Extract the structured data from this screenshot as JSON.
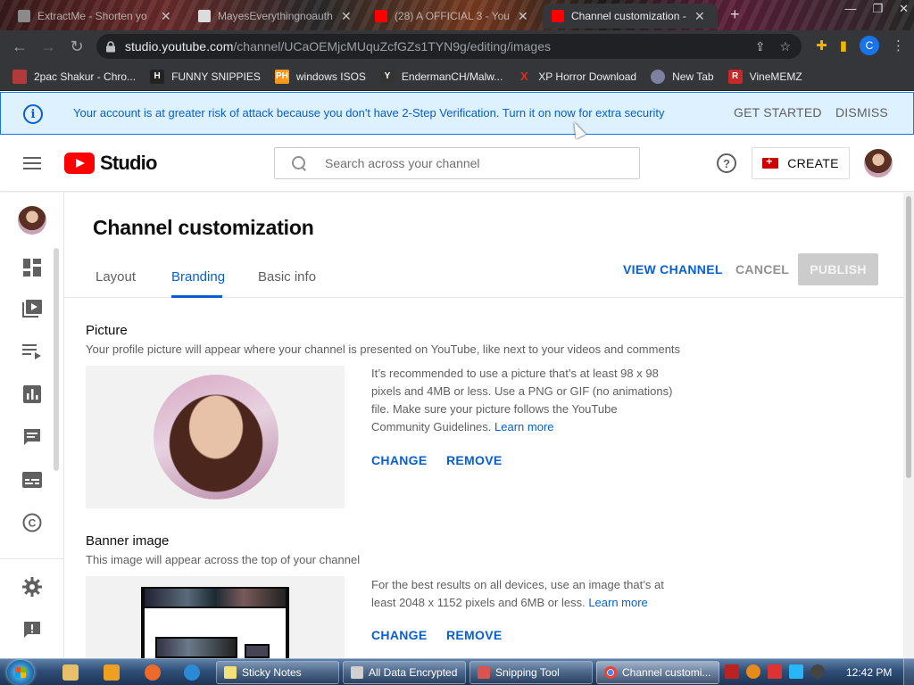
{
  "browser": {
    "tabs": [
      {
        "title": "ExtractMe - Shorten yo",
        "favicon_color": "#8a8a8a",
        "active": false
      },
      {
        "title": "MayesEverythingnoauth",
        "favicon_color": "#dcdcdc",
        "active": false
      },
      {
        "title": "(28) A OFFICIAL 3 - You",
        "favicon_color": "#ff0000",
        "active": false
      },
      {
        "title": "Channel customization -",
        "favicon_color": "#ff0000",
        "active": true
      }
    ],
    "url_host": "studio.youtube.com",
    "url_path": "/channel/UCaOEMjcMUquZcfGZs1TYN9g/editing/images",
    "profile_initial": "C",
    "bookmarks": [
      {
        "label": "2pac Shakur - Chro...",
        "icon": "",
        "color": "#b33a3a"
      },
      {
        "label": "FUNNY SNIPPIES",
        "icon": "H",
        "color": "#222222"
      },
      {
        "label": "windows ISOS",
        "icon": "PH",
        "color": "#f7971d"
      },
      {
        "label": "EndermanCH/Malw...",
        "icon": "Y",
        "color": "#333333"
      },
      {
        "label": "XP Horror Download",
        "icon": "X",
        "color": "#d93025"
      },
      {
        "label": "New Tab",
        "icon": "",
        "color": "#7f7f9f"
      },
      {
        "label": "VineMEMZ",
        "icon": "R",
        "color": "#c62828"
      }
    ]
  },
  "banner": {
    "message": "Your account is at greater risk of attack because you don't have 2-Step Verification. Turn it on now for extra security",
    "get_started": "GET STARTED",
    "dismiss": "DISMISS",
    "color": "#065fd4"
  },
  "header": {
    "brand": "Studio",
    "search_placeholder": "Search across your channel",
    "create_label": "CREATE"
  },
  "page": {
    "title": "Channel customization",
    "tabs": [
      {
        "label": "Layout",
        "active": false
      },
      {
        "label": "Branding",
        "active": true
      },
      {
        "label": "Basic info",
        "active": false
      }
    ],
    "view_channel": "VIEW CHANNEL",
    "cancel": "CANCEL",
    "publish": "PUBLISH"
  },
  "picture": {
    "title": "Picture",
    "description": "Your profile picture will appear where your channel is presented on YouTube, like next to your videos and comments",
    "help_text": "It’s recommended to use a picture that’s at least 98 x 98 pixels and 4MB or less. Use a PNG or GIF (no animations) file. Make sure your picture follows the YouTube Community Guidelines.",
    "learn_more": "Learn more",
    "change": "CHANGE",
    "remove": "REMOVE"
  },
  "banner_image": {
    "title": "Banner image",
    "description": "This image will appear across the top of your channel",
    "help_text": "For the best results on all devices, use an image that’s at least 2048 x 1152 pixels and 6MB or less.",
    "learn_more": "Learn more",
    "change": "CHANGE",
    "remove": "REMOVE"
  },
  "taskbar": {
    "tasks": [
      {
        "label": "Sticky Notes",
        "icon_color": "#f5e17a",
        "active": false
      },
      {
        "label": "All Data Encrypted",
        "icon_color": "#d0d0d0",
        "active": false
      },
      {
        "label": "Snipping Tool",
        "icon_color": "#d9534f",
        "active": false
      },
      {
        "label": "Channel customi...",
        "icon_color": "#e8e8e8",
        "active": true
      }
    ],
    "time": "12:42 PM"
  }
}
